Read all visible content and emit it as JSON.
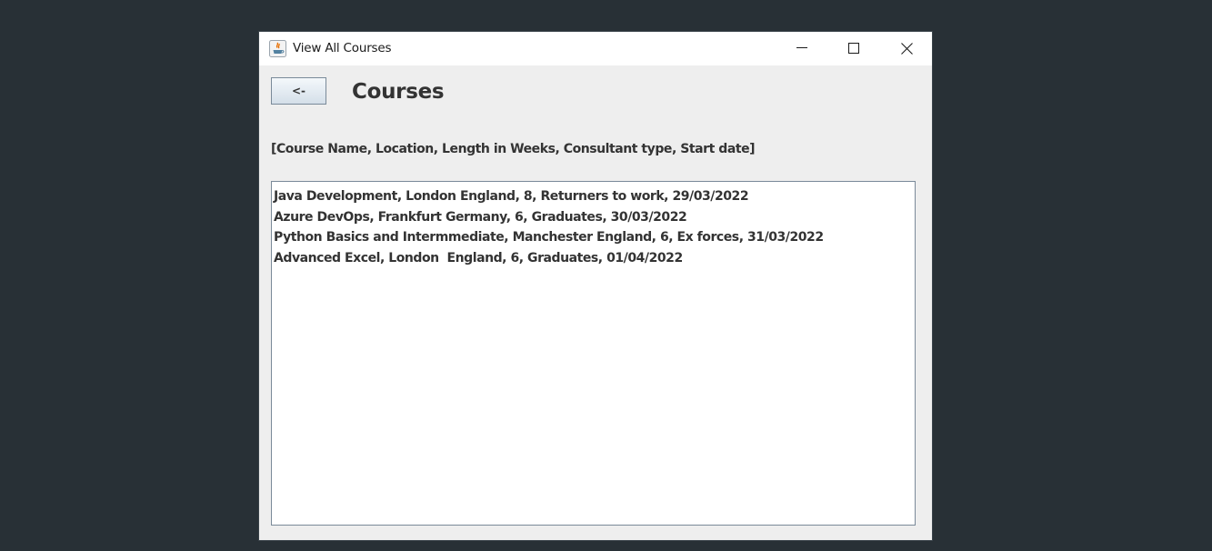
{
  "window": {
    "title": "View All Courses",
    "app_icon": "java-icon",
    "controls": [
      "minimize-icon",
      "maximize-icon",
      "close-icon"
    ]
  },
  "back_button": {
    "label": "<-"
  },
  "page_title": "Courses",
  "columns_label": "[Course Name, Location, Length in Weeks, Consultant type, Start date]",
  "courses": [
    "Java Development, London England, 8, Returners to work, 29/03/2022",
    "Azure DevOps, Frankfurt Germany, 6, Graduates, 30/03/2022",
    "Python Basics and Intermmediate, Manchester England, 6, Ex forces, 31/03/2022",
    "Advanced Excel, London  England, 6, Graduates, 01/04/2022"
  ]
}
